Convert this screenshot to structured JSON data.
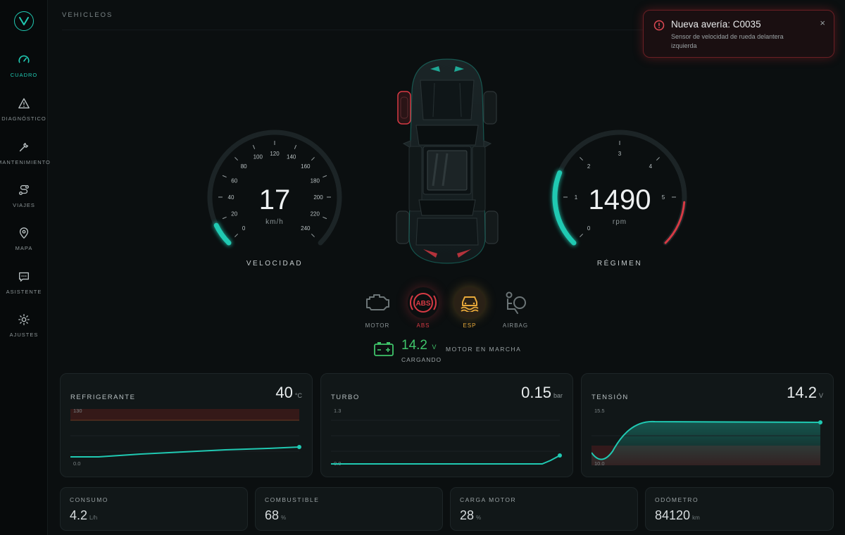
{
  "app": {
    "section_title": "VEHICLEOS"
  },
  "sidebar": {
    "items": [
      {
        "label": "CUADRO",
        "icon": "speedometer-icon",
        "active": true
      },
      {
        "label": "DIAGNÓSTICO",
        "icon": "warning-triangle-icon",
        "active": false
      },
      {
        "label": "MANTENIMIENTO",
        "icon": "wrench-icon",
        "active": false
      },
      {
        "label": "VIAJES",
        "icon": "route-icon",
        "active": false
      },
      {
        "label": "MAPA",
        "icon": "map-pin-icon",
        "active": false
      },
      {
        "label": "ASISTENTE",
        "icon": "chat-icon",
        "active": false
      },
      {
        "label": "AJUSTES",
        "icon": "sun-gear-icon",
        "active": false
      }
    ]
  },
  "toast": {
    "title": "Nueva avería: C0035",
    "body": "Sensor de velocidad de rueda delantera izquierda",
    "close": "×"
  },
  "speed_gauge": {
    "value": "17",
    "unit": "km/h",
    "title": "VELOCIDAD",
    "ticks": [
      "0",
      "20",
      "40",
      "60",
      "80",
      "100",
      "120",
      "140",
      "160",
      "180",
      "200",
      "220",
      "240"
    ],
    "max": 240,
    "current": 17
  },
  "rpm_gauge": {
    "value": "1490",
    "unit": "rpm",
    "title": "RÉGIMEN",
    "ticks": [
      "0",
      "1",
      "2",
      "3",
      "4",
      "5"
    ],
    "max": 6000,
    "current": 1490
  },
  "warnings": [
    {
      "label": "MOTOR",
      "icon": "engine-icon",
      "state": "off"
    },
    {
      "label": "ABS",
      "icon": "abs-icon",
      "state": "alert"
    },
    {
      "label": "ESP",
      "icon": "esp-icon",
      "state": "warning"
    },
    {
      "label": "AIRBAG",
      "icon": "airbag-icon",
      "state": "off"
    }
  ],
  "battery": {
    "value": "14.2",
    "unit": "V",
    "status": "CARGANDO",
    "engine_status": "MOTOR EN MARCHA"
  },
  "cards": [
    {
      "title": "REFRIGERANTE",
      "value": "40",
      "unit": "°C",
      "max_label": "130",
      "min_label": "0.0"
    },
    {
      "title": "TURBO",
      "value": "0.15",
      "unit": "bar",
      "max_label": "1.3",
      "min_label": "0.0"
    },
    {
      "title": "TENSIÓN",
      "value": "14.2",
      "unit": "V",
      "max_label": "15.5",
      "min_label": "10.0"
    }
  ],
  "stats": [
    {
      "title": "CONSUMO",
      "value": "4.2",
      "unit": "L/h"
    },
    {
      "title": "COMBUSTIBLE",
      "value": "68",
      "unit": "%"
    },
    {
      "title": "CARGA MOTOR",
      "value": "28",
      "unit": "%"
    },
    {
      "title": "ODÓMETRO",
      "value": "84120",
      "unit": "km"
    }
  ],
  "colors": {
    "accent": "#20c9b2",
    "alert": "#d63a44",
    "warning": "#e8a93a",
    "ok": "#3fc46a"
  }
}
